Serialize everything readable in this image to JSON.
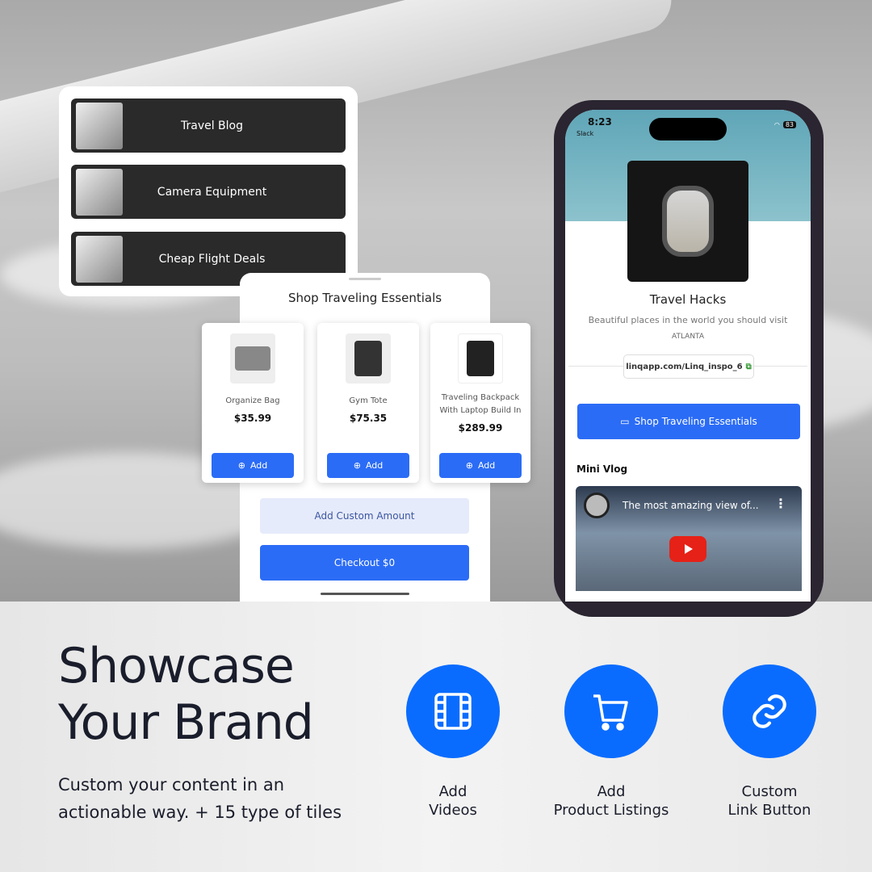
{
  "links": [
    {
      "label": "Travel Blog",
      "icon": "typewriter-thumbnail"
    },
    {
      "label": "Camera Equipment",
      "icon": "camera-thumbnail"
    },
    {
      "label": "Cheap Flight Deals",
      "icon": "luggage-thumbnail"
    }
  ],
  "shop": {
    "title": "Shop Traveling Essentials",
    "products": [
      {
        "name": "Organize Bag",
        "price": "$35.99",
        "add": "Add"
      },
      {
        "name": "Gym Tote",
        "price": "$75.35",
        "add": "Add"
      },
      {
        "name": "Traveling Backpack With Laptop Build In",
        "price": "$289.99",
        "add": "Add"
      }
    ],
    "custom_amount": "Add Custom Amount",
    "checkout": "Checkout $0"
  },
  "phone": {
    "time": "8:23",
    "back_app": "Slack",
    "battery": "83",
    "profile_name": "Travel Hacks",
    "bio": "Beautiful places in the world you should visit",
    "location": "ATLANTA",
    "link": "linqapp.com/Linq_inspo_6",
    "shop_button": "Shop Traveling Essentials",
    "section_title": "Mini Vlog",
    "video_title": "The most amazing view of..."
  },
  "marketing": {
    "headline_1": "Showcase",
    "headline_2": "Your Brand",
    "sub_1": "Custom your content in an",
    "sub_2": "actionable way. + 15 type of tiles",
    "features": [
      {
        "label": "Add\nVideos",
        "icon": "film-icon"
      },
      {
        "label": "Add\nProduct Listings",
        "icon": "cart-icon"
      },
      {
        "label": "Custom\nLink Button",
        "icon": "link-icon"
      }
    ]
  },
  "colors": {
    "accent": "#0a6cff",
    "button": "#2b6cf6",
    "dark_tile": "#2a2a2a"
  }
}
